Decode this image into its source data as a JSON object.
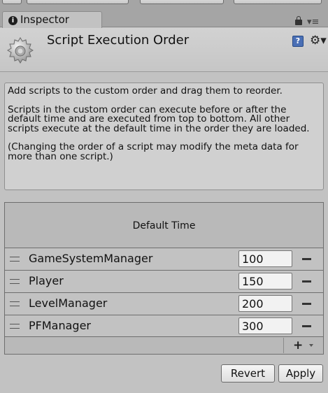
{
  "window": {
    "tab_label": "Inspector",
    "tab_icon": "info-icon"
  },
  "header": {
    "title": "Script Execution Order",
    "icon": "gear-icon"
  },
  "help": {
    "paragraphs": [
      "Add scripts to the custom order and drag them to reorder.",
      "Scripts in the custom order can execute before or after the default time and are executed from top to bottom. All other scripts execute at the default time in the order they are loaded.",
      "(Changing the order of a script may modify the meta data for more than one script.)"
    ]
  },
  "list": {
    "header_label": "Default Time",
    "rows": [
      {
        "name": "GameSystemManager",
        "order": "100"
      },
      {
        "name": "Player",
        "order": "150"
      },
      {
        "name": "LevelManager",
        "order": "200"
      },
      {
        "name": "PFManager",
        "order": "300"
      }
    ],
    "add_label": "+"
  },
  "buttons": {
    "revert": "Revert",
    "apply": "Apply"
  },
  "colors": {
    "panel_bg": "#c2c2c2",
    "help_bg": "#d0d0d0",
    "field_bg": "#f2f2f2"
  }
}
